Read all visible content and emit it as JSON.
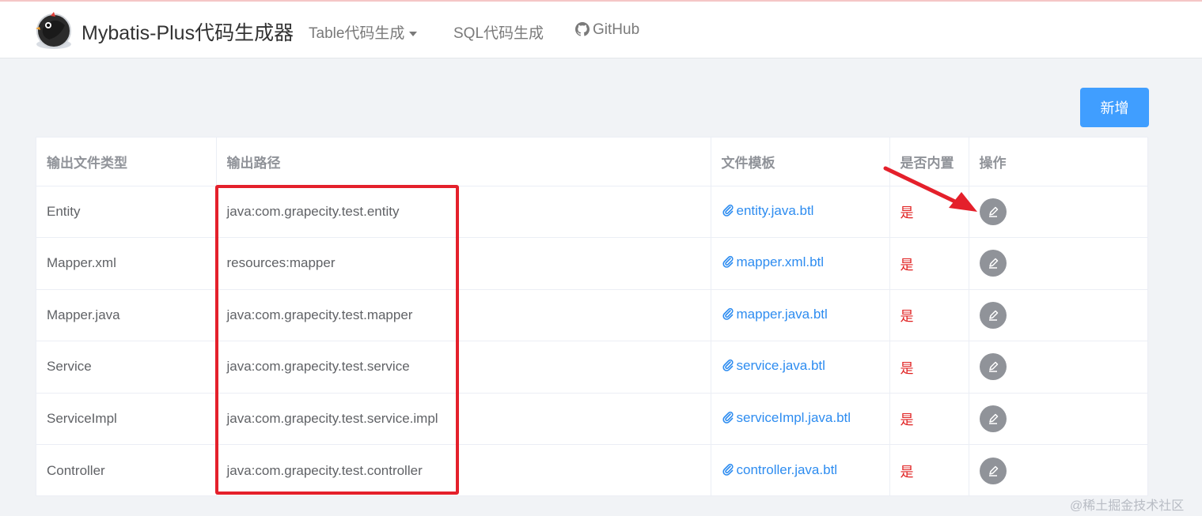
{
  "header": {
    "brand": "Mybatis-Plus代码生成器",
    "nav": {
      "table_gen": "Table代码生成",
      "sql_gen": "SQL代码生成",
      "github": "GitHub"
    }
  },
  "toolbar": {
    "add_label": "新增"
  },
  "table": {
    "columns": [
      "输出文件类型",
      "输出路径",
      "文件模板",
      "是否内置",
      "操作"
    ],
    "rows": [
      {
        "type": "Entity",
        "path": "java:com.grapecity.test.entity",
        "template": "entity.java.btl",
        "builtin": "是"
      },
      {
        "type": "Mapper.xml",
        "path": "resources:mapper",
        "template": "mapper.xml.btl",
        "builtin": "是"
      },
      {
        "type": "Mapper.java",
        "path": "java:com.grapecity.test.mapper",
        "template": "mapper.java.btl",
        "builtin": "是"
      },
      {
        "type": "Service",
        "path": "java:com.grapecity.test.service",
        "template": "service.java.btl",
        "builtin": "是"
      },
      {
        "type": "ServiceImpl",
        "path": "java:com.grapecity.test.service.impl",
        "template": "serviceImpl.java.btl",
        "builtin": "是"
      },
      {
        "type": "Controller",
        "path": "java:com.grapecity.test.controller",
        "template": "controller.java.btl",
        "builtin": "是"
      }
    ]
  },
  "icons": {
    "logo": "bird-logo-icon",
    "github": "github-icon",
    "template_link": "paperclip-icon",
    "edit": "edit-pencil-icon"
  },
  "colors": {
    "primary": "#409eff",
    "link": "#2d8cf0",
    "builtin": "#e02020",
    "highlight": "#e4202b",
    "edit_button": "#909399"
  },
  "watermark": "@稀土掘金技术社区"
}
